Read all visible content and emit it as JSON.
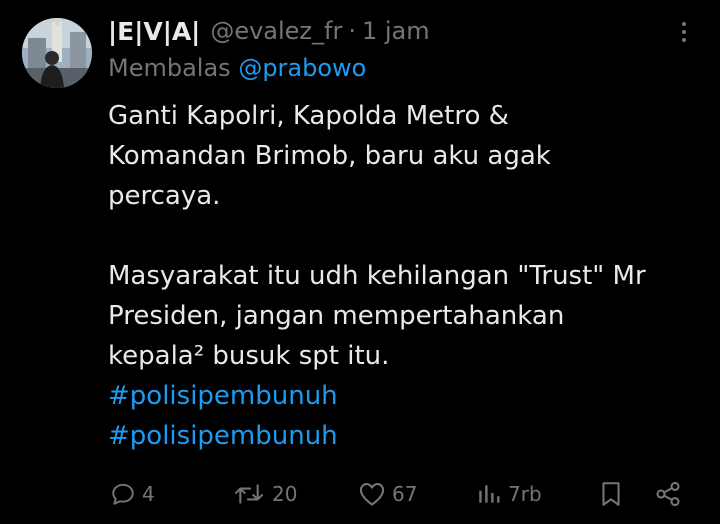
{
  "tweet": {
    "display_name": "|E|V|A|",
    "handle": "@evalez_fr",
    "separator": "·",
    "time": "1 jam",
    "reply_prefix": "Membalas",
    "reply_mention": "@prabowo",
    "text_paragraph_1": [
      "Ganti Kapolri, Kapolda Metro &",
      "Komandan Brimob, baru aku agak",
      "percaya."
    ],
    "text_paragraph_2": [
      "Masyarakat itu udh kehilangan \"Trust\" Mr",
      "Presiden, jangan mempertahankan",
      "kepala² busuk spt itu."
    ],
    "hashtags": [
      "#polisipembunuh",
      "#polisipembunuh"
    ]
  },
  "actions": {
    "replies": "4",
    "reposts": "20",
    "likes": "67",
    "views": "7rb"
  },
  "colors": {
    "background": "#000000",
    "text": "#e7e9ea",
    "muted": "#71767b",
    "link": "#1d9bf0"
  },
  "icons": [
    "more-icon",
    "reply-icon",
    "repost-icon",
    "like-icon",
    "views-icon",
    "bookmark-icon",
    "share-icon"
  ]
}
